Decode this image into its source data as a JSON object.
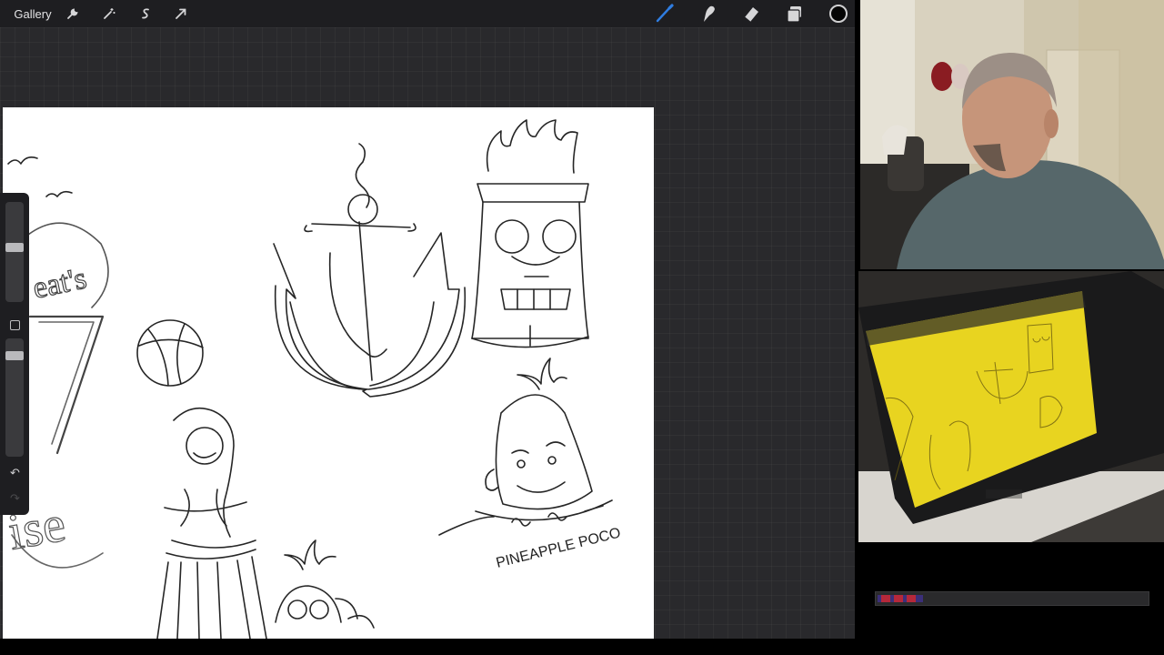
{
  "toolbar": {
    "gallery_label": "Gallery",
    "left_icons": [
      "wrench-icon",
      "magic-wand-icon",
      "selection-icon",
      "transform-arrow-icon"
    ],
    "right_icons": [
      "brush-icon",
      "smudge-icon",
      "eraser-icon",
      "layers-icon",
      "color-picker-icon"
    ],
    "current_color": "#050505",
    "brush_accent": "#2f7de1"
  },
  "sidebar": {
    "icons": [
      "brush-size-slider",
      "modify-square-icon",
      "opacity-slider",
      "undo-icon",
      "redo-icon"
    ],
    "brush_size": 0.45,
    "opacity": 0.12
  },
  "canvas": {
    "sketch_caption": "PINEAPPLE POCO",
    "sign_fragment_1": "eat's",
    "sign_fragment_2": "ise"
  },
  "overlay": {
    "progress": 0.17
  },
  "colors": {
    "interface_bg": "#242427",
    "topbar_bg": "#1e1e21",
    "paper": "#ffffff",
    "overhead_paper": "#e8d420"
  }
}
